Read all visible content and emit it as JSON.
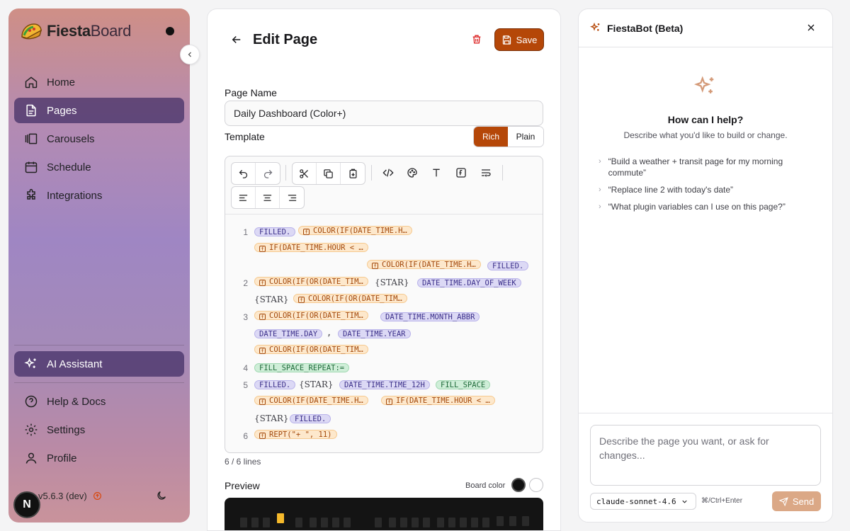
{
  "sidebar": {
    "logo_part1": "Fiesta",
    "logo_part2": "Board",
    "nav": [
      {
        "label": "Home",
        "icon": "home-icon"
      },
      {
        "label": "Pages",
        "icon": "document-icon",
        "active": true
      },
      {
        "label": "Carousels",
        "icon": "carousel-icon"
      },
      {
        "label": "Schedule",
        "icon": "calendar-icon"
      },
      {
        "label": "Integrations",
        "icon": "puzzle-icon"
      }
    ],
    "ai_assistant": "AI Assistant",
    "bottom_nav": [
      {
        "label": "Help & Docs",
        "icon": "help-icon"
      },
      {
        "label": "Settings",
        "icon": "gear-icon"
      },
      {
        "label": "Profile",
        "icon": "user-icon"
      }
    ],
    "version": "v5.6.3 (dev)",
    "avatar_letter": "N"
  },
  "editor": {
    "title": "Edit Page",
    "save_label": "Save",
    "page_name_label": "Page Name",
    "page_name_value": "Daily Dashboard (Color+)",
    "template_label": "Template",
    "mode_rich": "Rich",
    "mode_plain": "Plain",
    "lines_count": "6 / 6 lines",
    "preview_label": "Preview",
    "board_color_label": "Board color",
    "code": {
      "l1": "1",
      "l2": "2",
      "l3": "3",
      "l4": "4",
      "l5": "5",
      "l6": "6",
      "filled": "FILLED.",
      "color_if_dt_h": "COLOR(IF(DATE_TIME.H…",
      "if_dt_hour": "IF(DATE_TIME.HOUR < …",
      "color_if_or_dt": "COLOR(IF(OR(DATE_TIM…",
      "star": "{STAR}",
      "day_of_week": "DATE_TIME.DAY_OF_WEEK",
      "month_abbr": "DATE_TIME.MONTH_ABBR",
      "day": "DATE_TIME.DAY",
      "comma": ",",
      "year": "DATE_TIME.YEAR",
      "fill_repeat": "FILL_SPACE_REPEAT:=",
      "time_12h": "DATE_TIME.TIME_12H",
      "fill_space": "FILL_SPACE",
      "rept": "REPT(\"+ \", 11)"
    }
  },
  "chat": {
    "title": "FiestaBot (Beta)",
    "help_title": "How can I help?",
    "help_sub": "Describe what you'd like to build or change.",
    "suggestions": [
      "“Build a weather + transit page for my morning commute”",
      "“Replace line 2 with today's date”",
      "“What plugin variables can I use on this page?”"
    ],
    "input_placeholder": "Describe the page you want, or ask for changes...",
    "model": "claude-sonnet-4.6",
    "shortcut": "⌘/Ctrl+Enter",
    "send_label": "Send"
  },
  "colors": {
    "accent": "#b54708",
    "nav_active": "#4e3a7a",
    "board_black": "#111111",
    "board_white": "#ffffff"
  }
}
